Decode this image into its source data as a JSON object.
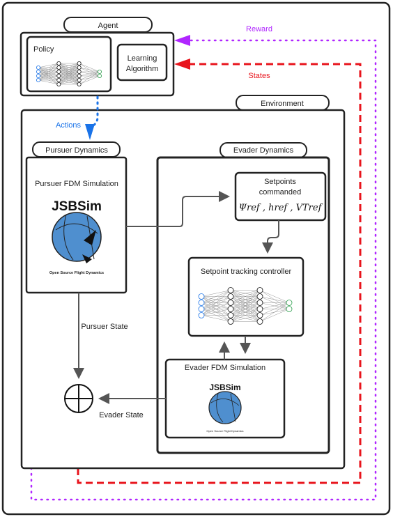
{
  "agent": {
    "label": "Agent",
    "policy": "Policy",
    "learning_line1": "Learning",
    "learning_line2": "Algorithm"
  },
  "environment": {
    "label": "Environment"
  },
  "signals": {
    "reward": "Reward",
    "states": "States",
    "actions": "Actions",
    "pursuer_state": "Pursuer State",
    "evader_state": "Evader State"
  },
  "pursuer": {
    "label": "Pursuer Dynamics",
    "sim": "Pursuer FDM Simulation",
    "logo": "JSBSim",
    "logo_caption": "Open Source Flight Dynamics"
  },
  "evader": {
    "label": "Evader Dynamics",
    "setpoints_line1": "Setpoints",
    "setpoints_line2": "commanded",
    "setpoints_formula": "Ψref , href , VTref",
    "controller": "Setpoint tracking controller",
    "sim": "Evader FDM Simulation",
    "logo": "JSBSim",
    "logo_caption": "Open Source Flight Dynamics"
  },
  "colors": {
    "reward": "#b026ff",
    "states": "#e8141c",
    "actions": "#1a73e8",
    "border": "#222222",
    "connector": "#555555"
  }
}
